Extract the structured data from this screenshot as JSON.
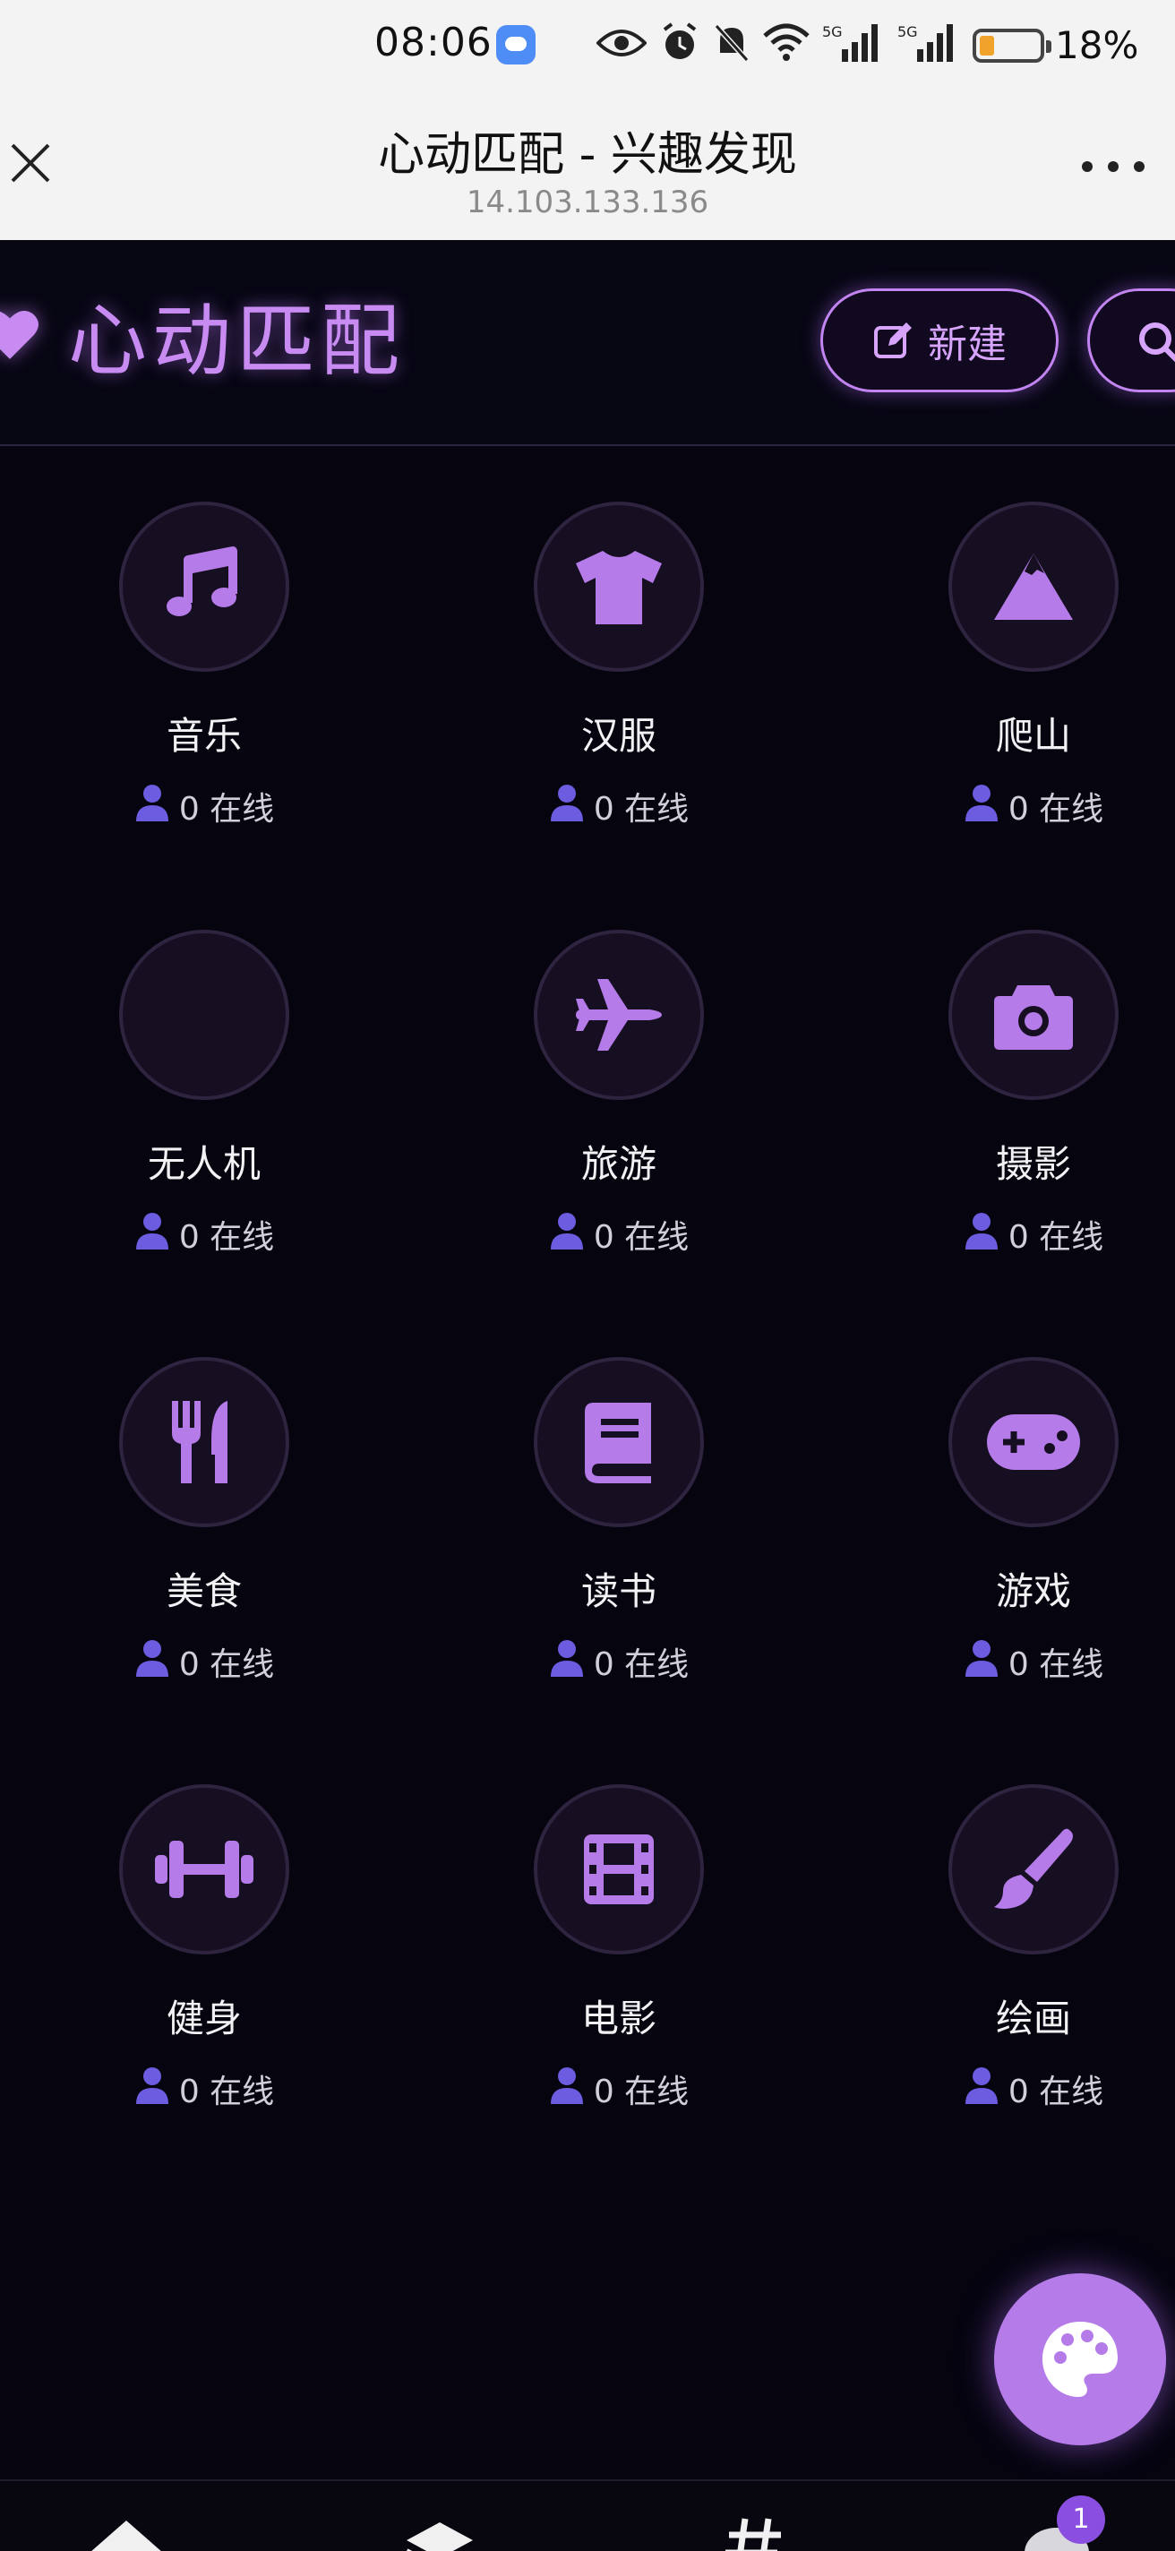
{
  "status_bar": {
    "time": "08:06",
    "signal_label": "5G",
    "battery_percent": "18%",
    "battery_level": 0.18
  },
  "browser": {
    "title": "心动匹配 - 兴趣发现",
    "url": "14.103.133.136"
  },
  "header": {
    "brand": "心动匹配",
    "new_button": "新建"
  },
  "colors": {
    "accent": "#c78bf2",
    "icon": "#b57be8",
    "user": "#6b5ce0",
    "background": "#05040f"
  },
  "online_suffix": "在线",
  "interests": [
    {
      "name": "音乐",
      "icon": "music-icon",
      "online": "0 在线"
    },
    {
      "name": "汉服",
      "icon": "shirt-icon",
      "online": "0 在线"
    },
    {
      "name": "爬山",
      "icon": "mountain-icon",
      "online": "0 在线"
    },
    {
      "name": "无人机",
      "icon": "drone-icon",
      "online": "0 在线"
    },
    {
      "name": "旅游",
      "icon": "plane-icon",
      "online": "0 在线"
    },
    {
      "name": "摄影",
      "icon": "camera-icon",
      "online": "0 在线"
    },
    {
      "name": "美食",
      "icon": "utensils-icon",
      "online": "0 在线"
    },
    {
      "name": "读书",
      "icon": "book-icon",
      "online": "0 在线"
    },
    {
      "name": "游戏",
      "icon": "gamepad-icon",
      "online": "0 在线"
    },
    {
      "name": "健身",
      "icon": "dumbbell-icon",
      "online": "0 在线"
    },
    {
      "name": "电影",
      "icon": "film-icon",
      "online": "0 在线"
    },
    {
      "name": "绘画",
      "icon": "paintbrush-icon",
      "online": "0 在线"
    }
  ],
  "bottom_nav": {
    "items": [
      "home-icon",
      "layers-icon",
      "hashtag-icon",
      "chat-icon"
    ],
    "chat_badge": "1"
  }
}
